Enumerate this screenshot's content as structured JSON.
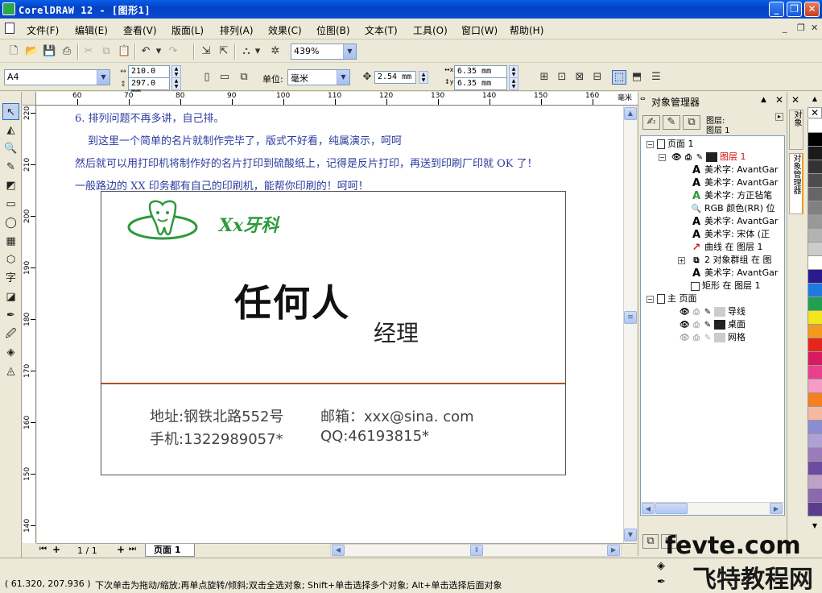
{
  "window": {
    "title": "CorelDRAW 12 - [图形1]"
  },
  "menu": [
    "文件(F)",
    "编辑(E)",
    "查看(V)",
    "版面(L)",
    "排列(A)",
    "效果(C)",
    "位图(B)",
    "文本(T)",
    "工具(O)",
    "窗口(W)",
    "帮助(H)"
  ],
  "toolbar": {
    "zoom": "439%"
  },
  "property_bar": {
    "page_size": "A4",
    "width": "210.0 mm",
    "height": "297.0 mm",
    "unit_label": "单位:",
    "unit": "毫米",
    "nudge": "2.54 mm",
    "dup_x": "6.35 mm",
    "dup_y": "6.35 mm"
  },
  "ruler": {
    "unit": "毫米",
    "h_ticks": [
      "60",
      "70",
      "80",
      "90",
      "100",
      "110",
      "120",
      "130",
      "140",
      "150",
      "160"
    ],
    "v_ticks": [
      "220",
      "210",
      "200",
      "190",
      "180",
      "170",
      "160",
      "150",
      "140"
    ]
  },
  "canvas_text": [
    "6. 排列问题不再多讲，自己排。",
    "到这里一个简单的名片就制作完毕了，版式不好看，纯属演示，呵呵",
    "然后就可以用打印机将制作好的名片打印到硫酸纸上，记得是反片打印，再送到印刷厂印就 OK 了！",
    "一般路边的 XX 印务都有自己的印刷机，能帮你印刷的！呵呵！"
  ],
  "card": {
    "brand": "Xx牙科",
    "name": "任何人",
    "role": "经理",
    "address": "地址:钢铁北路552号",
    "email": "邮箱：xxx@sina. com",
    "phone": "手机:1322989057*",
    "qq": "QQ:46193815*"
  },
  "page_nav": {
    "counter": "1 / 1",
    "tab": "页面 1"
  },
  "docker": {
    "title": "对象管理器",
    "layer_label": "图层:",
    "layer_value": "图层 1",
    "tree": [
      {
        "level": 0,
        "label": "页面 1",
        "icon": "page-icon"
      },
      {
        "level": 1,
        "label": "图层 1",
        "icon": "layer-icon",
        "highlight": true
      },
      {
        "level": 2,
        "label": "美术字: AvantGar",
        "icon": "text-A-icon"
      },
      {
        "level": 2,
        "label": "美术字: AvantGar",
        "icon": "text-A-icon"
      },
      {
        "level": 2,
        "label": "美术字: 方正毡笔",
        "icon": "text-A-icon"
      },
      {
        "level": 2,
        "label": "RGB 颜色(RR) 位",
        "icon": "bitmap-icon"
      },
      {
        "level": 2,
        "label": "美术字: AvantGar",
        "icon": "text-A-icon"
      },
      {
        "level": 2,
        "label": "美术字: 宋体 (正",
        "icon": "text-A-icon"
      },
      {
        "level": 2,
        "label": "曲线 在 图层 1",
        "icon": "curve-icon"
      },
      {
        "level": 2,
        "label": "2 对象群组 在 图",
        "icon": "group-icon"
      },
      {
        "level": 2,
        "label": "美术字: AvantGar",
        "icon": "text-A-icon"
      },
      {
        "level": 2,
        "label": "矩形 在 图层 1",
        "icon": "rect-icon"
      },
      {
        "level": 0,
        "label": "主 页面",
        "icon": "page-icon"
      },
      {
        "level": 1,
        "label": "导线",
        "icon": "layer-icon"
      },
      {
        "level": 1,
        "label": "桌面",
        "icon": "layer-icon"
      },
      {
        "level": 1,
        "label": "网格",
        "icon": "layer-icon"
      }
    ]
  },
  "side_tabs": [
    "对象",
    "对象管理器"
  ],
  "palette": [
    "#ffffff",
    "#000000",
    "#1a1a1a",
    "#333333",
    "#4d4d4d",
    "#666666",
    "#808080",
    "#999999",
    "#b3b3b3",
    "#cccccc",
    "#ffffff",
    "#2b1a8c",
    "#1f7ae0",
    "#20a050",
    "#f2e61c",
    "#f29a1c",
    "#e6261c",
    "#d81b60",
    "#e8408c",
    "#f49cc4",
    "#f48020",
    "#f5b8a0",
    "#8c8cd0",
    "#b0a0d8",
    "#9c7cb8",
    "#6c4ca0",
    "#c0a0c8",
    "#8c68b0",
    "#5a3c8c"
  ],
  "status": {
    "coords": "( 61.320, 207.936 )",
    "message": "下次单击为拖动/缩放;再单点旋转/倾斜;双击全选对象; Shift+单击选择多个对象; Alt+单击选择后面对象"
  },
  "watermark": {
    "line1": "fevte.com",
    "line2": "飞特教程网"
  }
}
